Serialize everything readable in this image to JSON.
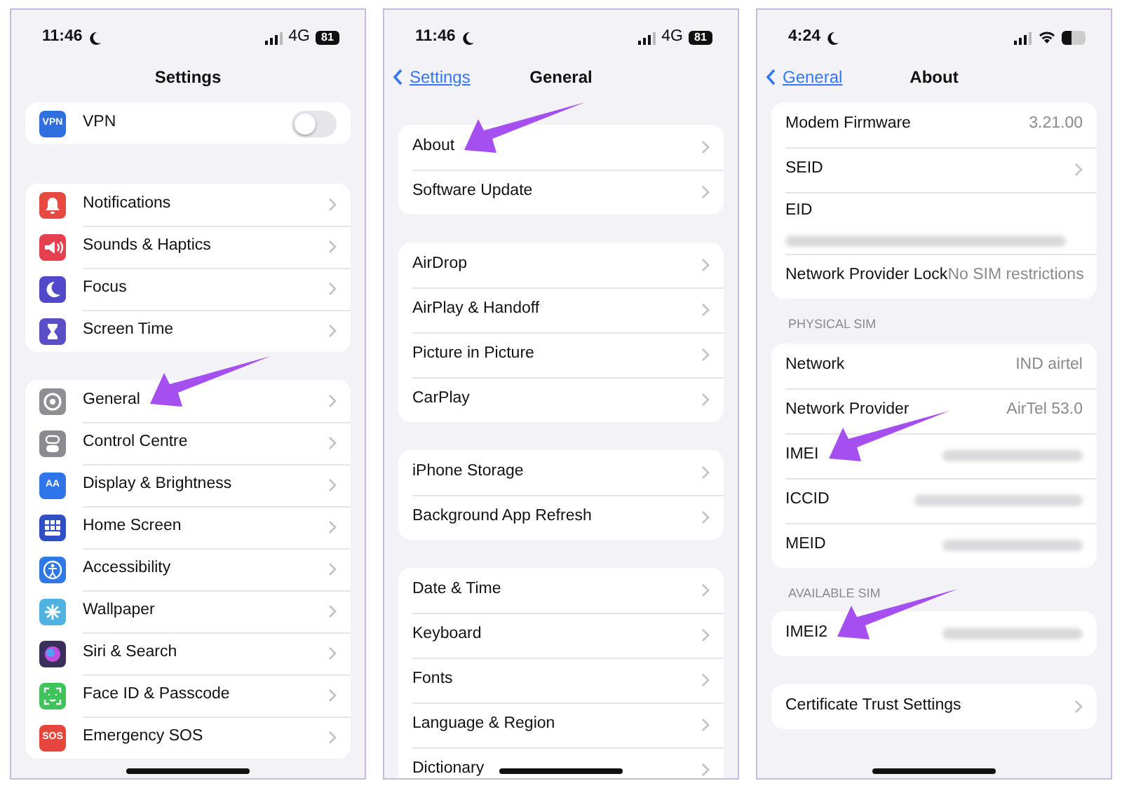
{
  "panels": [
    {
      "status_bar": {
        "time": "11:46",
        "network": "4G",
        "battery": "81"
      },
      "nav": {
        "title": "Settings"
      },
      "groups": [
        {
          "rows": [
            {
              "kind": "toggle",
              "label": "VPN",
              "icon_text": "VPN",
              "color": "#2f6fe0",
              "on": false,
              "arrow": false
            }
          ]
        },
        {
          "rows": [
            {
              "kind": "link",
              "label": "Notifications",
              "color": "#e5493f",
              "arrow": false
            },
            {
              "kind": "link",
              "label": "Sounds & Haptics",
              "color": "#e5404f",
              "arrow": false
            },
            {
              "kind": "link",
              "label": "Focus",
              "color": "#5149c9",
              "arrow": false
            },
            {
              "kind": "link",
              "label": "Screen Time",
              "color": "#5a4fc7",
              "arrow": false
            }
          ]
        },
        {
          "rows": [
            {
              "kind": "link",
              "label": "General",
              "color": "#8e8e93",
              "arrow": true
            },
            {
              "kind": "link",
              "label": "Control Centre",
              "color": "#8a8a90",
              "arrow": false
            },
            {
              "kind": "link",
              "label": "Display & Brightness",
              "icon_text": "AA",
              "color": "#2f74e8",
              "arrow": false
            },
            {
              "kind": "link",
              "label": "Home Screen",
              "color": "#2f4fc7",
              "arrow": false
            },
            {
              "kind": "link",
              "label": "Accessibility",
              "color": "#2f78e6",
              "arrow": false
            },
            {
              "kind": "link",
              "label": "Wallpaper",
              "color": "#4fb2e0",
              "arrow": false
            },
            {
              "kind": "link",
              "label": "Siri & Search",
              "color": "#3a2f5a",
              "arrow": false
            },
            {
              "kind": "link",
              "label": "Face ID & Passcode",
              "color": "#3ec45b",
              "arrow": false
            },
            {
              "kind": "link",
              "label": "Emergency SOS",
              "icon_text": "SOS",
              "color": "#e5453a",
              "arrow": false
            }
          ]
        }
      ]
    },
    {
      "status_bar": {
        "time": "11:46",
        "network": "4G",
        "battery": "81"
      },
      "nav": {
        "back": "Settings",
        "title": "General"
      },
      "groups": [
        {
          "rows": [
            {
              "kind": "link",
              "label": "About",
              "arrow": true
            },
            {
              "kind": "link",
              "label": "Software Update",
              "arrow": false
            }
          ]
        },
        {
          "rows": [
            {
              "kind": "link",
              "label": "AirDrop",
              "arrow": false
            },
            {
              "kind": "link",
              "label": "AirPlay & Handoff",
              "arrow": false
            },
            {
              "kind": "link",
              "label": "Picture in Picture",
              "arrow": false
            },
            {
              "kind": "link",
              "label": "CarPlay",
              "arrow": false
            }
          ]
        },
        {
          "rows": [
            {
              "kind": "link",
              "label": "iPhone Storage",
              "arrow": false
            },
            {
              "kind": "link",
              "label": "Background App Refresh",
              "arrow": false
            }
          ]
        },
        {
          "rows": [
            {
              "kind": "link",
              "label": "Date & Time",
              "arrow": false
            },
            {
              "kind": "link",
              "label": "Keyboard",
              "arrow": false
            },
            {
              "kind": "link",
              "label": "Fonts",
              "arrow": false
            },
            {
              "kind": "link",
              "label": "Language & Region",
              "arrow": false
            },
            {
              "kind": "link",
              "label": "Dictionary",
              "arrow": false
            }
          ]
        }
      ]
    },
    {
      "status_bar": {
        "time": "4:24",
        "wifi": true
      },
      "nav": {
        "back": "General",
        "title": "About"
      },
      "groups": [
        {
          "rows": [
            {
              "kind": "value",
              "label": "Modem Firmware",
              "value": "3.21.00",
              "arrow": false
            },
            {
              "kind": "link",
              "label": "SEID",
              "arrow": false
            },
            {
              "kind": "stacked",
              "label": "EID",
              "arrow": false
            },
            {
              "kind": "value",
              "label": "Network Provider Lock",
              "value": "No SIM restrictions",
              "arrow": false
            }
          ]
        },
        {
          "header": "PHYSICAL SIM",
          "rows": [
            {
              "kind": "value",
              "label": "Network",
              "value": "IND airtel",
              "arrow": false
            },
            {
              "kind": "value",
              "label": "Network Provider",
              "value": "AirTel 53.0",
              "arrow": false
            },
            {
              "kind": "hidden",
              "label": "IMEI",
              "arrow": true
            },
            {
              "kind": "hidden",
              "label": "ICCID",
              "arrow": false
            },
            {
              "kind": "hidden",
              "label": "MEID",
              "arrow": false
            }
          ]
        },
        {
          "header": "AVAILABLE SIM",
          "rows": [
            {
              "kind": "hidden",
              "label": "IMEI2",
              "arrow": true
            }
          ]
        },
        {
          "rows": [
            {
              "kind": "link",
              "label": "Certificate Trust Settings",
              "arrow": false
            }
          ]
        }
      ]
    }
  ]
}
